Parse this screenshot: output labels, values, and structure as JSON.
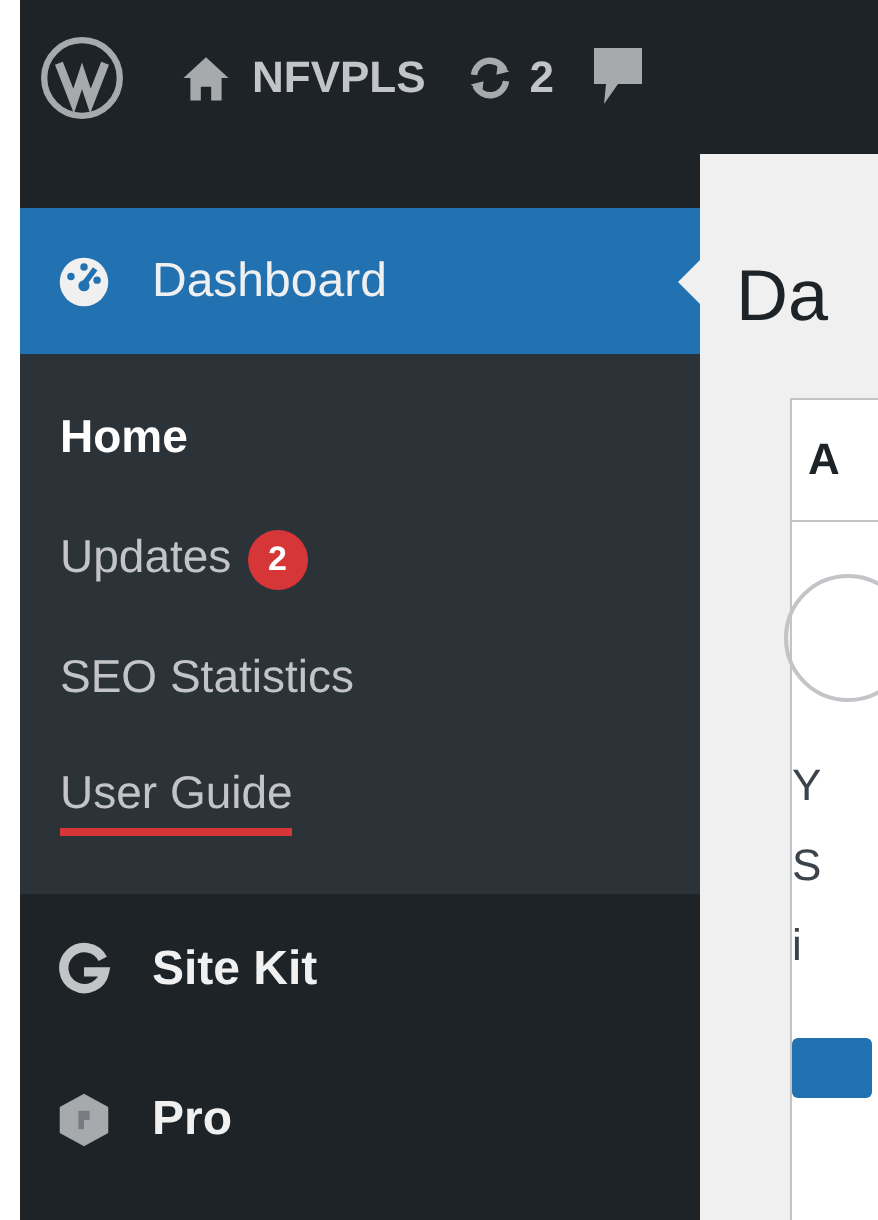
{
  "admin_bar": {
    "site_name": "NFVPLS",
    "updates_count": "2"
  },
  "sidebar": {
    "menu": [
      {
        "kind": "parent",
        "label": "Dashboard",
        "selected": true,
        "children": [
          {
            "label": "Home",
            "selected": true,
            "underlined": false
          },
          {
            "label": "Updates",
            "selected": false,
            "badge": "2",
            "underlined": false
          },
          {
            "label": "SEO Statistics",
            "selected": false,
            "underlined": false
          },
          {
            "label": "User Guide",
            "selected": false,
            "underlined": true
          }
        ]
      },
      {
        "kind": "item",
        "label": "Site Kit",
        "selected": false
      },
      {
        "kind": "item",
        "label": "Pro",
        "selected": false
      }
    ]
  },
  "content": {
    "heading": "Da",
    "card": {
      "title": "A",
      "lines": [
        "Y",
        "S",
        "i"
      ]
    }
  }
}
